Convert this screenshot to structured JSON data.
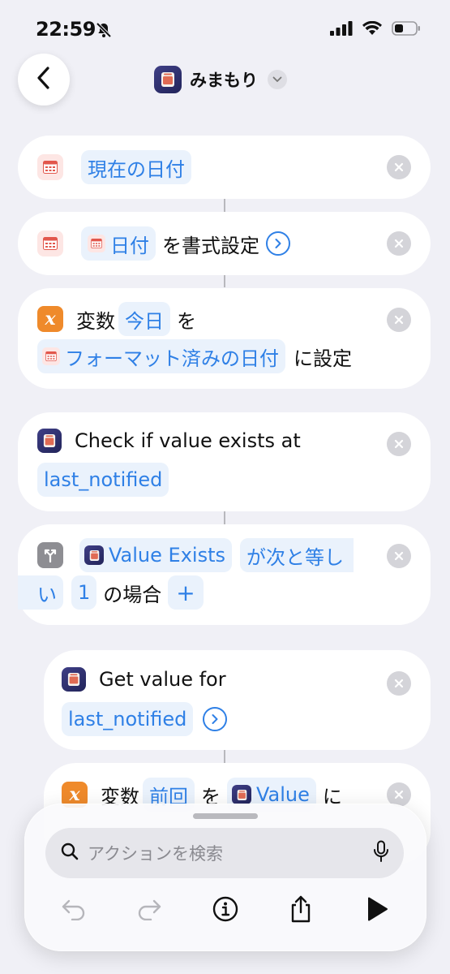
{
  "status": {
    "time": "22:59"
  },
  "header": {
    "title": "みまもり"
  },
  "actions": [
    {
      "token": "現在の日付"
    },
    {
      "token": "日付",
      "text": "を書式設定"
    },
    {
      "prefix": "変数",
      "var_token": "今日",
      "text1": "を",
      "date_token": "フォーマット済みの日付",
      "text2": "に設定"
    },
    {
      "text": "Check if value exists at",
      "token": "last_notified"
    },
    {
      "token1": "Value Exists",
      "token2a": "が次と等し",
      "token2b": "い",
      "token3": "1",
      "text": "の場合",
      "add": "+"
    },
    {
      "text": "Get value for",
      "token": "last_notified"
    },
    {
      "prefix": "変数",
      "var_token": "前回",
      "text1": "を",
      "value_token": "Value",
      "text2": "に"
    }
  ],
  "search": {
    "placeholder": "アクションを検索"
  },
  "colors": {
    "accent": "#2f80e6",
    "var_orange": "#ef8a2b",
    "app_icon": "#2c2d6b",
    "background": "#f0f0f6"
  }
}
